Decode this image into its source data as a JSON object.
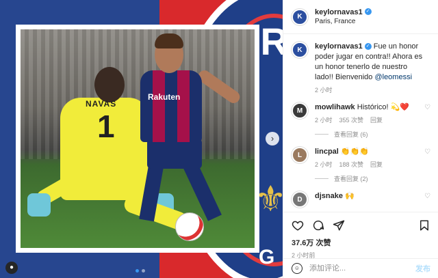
{
  "post": {
    "author": "keylornavas1",
    "location": "Paris, France",
    "caption_user": "keylornavas1",
    "caption_text": " Fue un honor poder jugar en contra!! Ahora es un honor tenerlo de nuestro lado!! Bienvenido ",
    "caption_mention": "@leomessi",
    "caption_time": "2 小时",
    "image": {
      "badge_text": "AR",
      "badge_letter": "G",
      "fleur": "⚜",
      "keeper_name": "NAVAS",
      "keeper_number": "1",
      "sponsor": "Rakuten",
      "nav_next": "›"
    }
  },
  "comments": [
    {
      "user": "mowlihawk",
      "text": " Histórico! 💫❤️",
      "time": "2 小时",
      "likes": "355 次赞",
      "reply": "回复",
      "view_replies": "查看回复 (6)"
    },
    {
      "user": "lincpal",
      "text": " 👏👏👏",
      "time": "2 小时",
      "likes": "188 次赞",
      "reply": "回复",
      "view_replies": "查看回复 (2)"
    },
    {
      "user": "djsnake",
      "text": " 🙌",
      "time": "",
      "likes": "",
      "reply": "",
      "view_replies": ""
    }
  ],
  "actions": {
    "likes_count": "37.6万 次赞",
    "timestamp": "2 小时前"
  },
  "add_comment": {
    "placeholder": "添加评论...",
    "post_label": "发布"
  }
}
